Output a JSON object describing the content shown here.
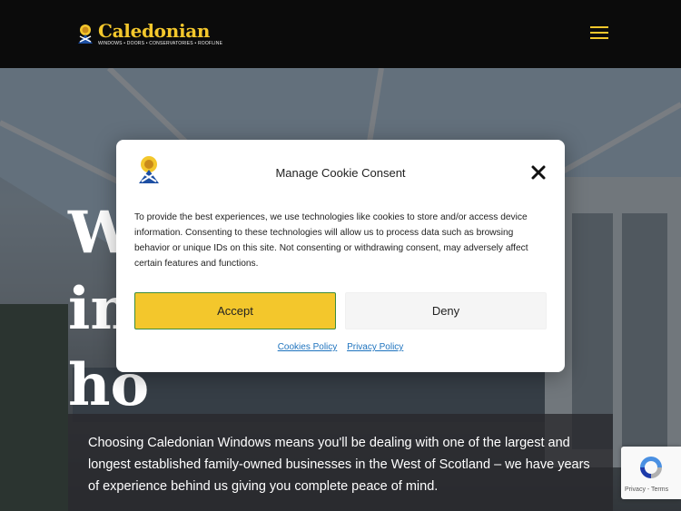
{
  "header": {
    "brand_name": "Caledonian",
    "brand_tagline": "WINDOWS • DOORS • CONSERVATORIES • ROOFLINE",
    "menu_icon": "hamburger-menu-icon",
    "accent_color": "#f3c72c"
  },
  "hero": {
    "heading": "W\nin\nho",
    "body": "Choosing Caledonian Windows means you'll be dealing with one of the largest and longest established family-owned businesses in the West of Scotland – we have years of experience behind us giving you complete peace of mind."
  },
  "cookie_modal": {
    "title": "Manage Cookie Consent",
    "body": "To provide the best experiences, we use technologies like cookies to store and/or access device information. Consenting to these technologies will allow us to process data such as browsing behavior or unique IDs on this site. Not consenting or withdrawing consent, may adversely affect certain features and functions.",
    "accept_label": "Accept",
    "deny_label": "Deny",
    "cookies_policy_link": "Cookies Policy",
    "privacy_policy_link": "Privacy Policy",
    "close_icon": "close-icon"
  },
  "recaptcha": {
    "links": "Privacy - Terms"
  }
}
